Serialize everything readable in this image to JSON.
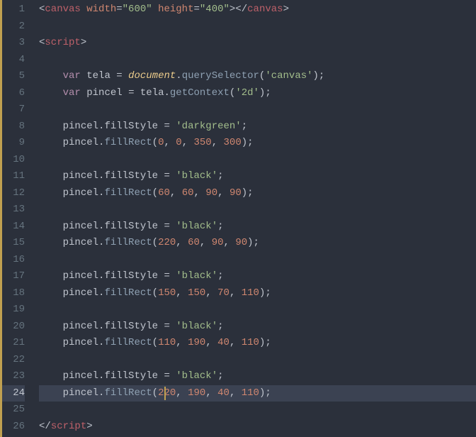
{
  "lines": [
    {
      "n": "1",
      "html": "<span class='punc'>&lt;</span><span class='tag'>canvas</span> <span class='attr'>width</span><span class='punc'>=</span><span class='str'>\"600\"</span> <span class='attr'>height</span><span class='punc'>=</span><span class='str'>\"400\"</span><span class='punc'>&gt;&lt;/</span><span class='tag'>canvas</span><span class='punc'>&gt;</span>"
    },
    {
      "n": "2",
      "html": ""
    },
    {
      "n": "3",
      "html": "<span class='punc'>&lt;</span><span class='tag'>script</span><span class='punc'>&gt;</span>"
    },
    {
      "n": "4",
      "html": ""
    },
    {
      "n": "5",
      "html": "    <span class='kw'>var</span> <span class='ident'>tela</span> <span class='punc'>=</span> <span class='obj'>document</span><span class='punc'>.</span><span class='prop'>querySelector</span><span class='punc'>(</span><span class='str'>'canvas'</span><span class='punc'>);</span>"
    },
    {
      "n": "6",
      "html": "    <span class='kw'>var</span> <span class='ident'>pincel</span> <span class='punc'>=</span> <span class='ident'>tela</span><span class='punc'>.</span><span class='prop'>getContext</span><span class='punc'>(</span><span class='str'>'2d'</span><span class='punc'>);</span>"
    },
    {
      "n": "7",
      "html": ""
    },
    {
      "n": "8",
      "html": "    <span class='ident'>pincel</span><span class='punc'>.</span><span class='ident'>fillStyle</span> <span class='punc'>=</span> <span class='str'>'darkgreen'</span><span class='punc'>;</span>"
    },
    {
      "n": "9",
      "html": "    <span class='ident'>pincel</span><span class='punc'>.</span><span class='prop'>fillRect</span><span class='punc'>(</span><span class='num'>0</span><span class='punc'>,</span> <span class='num'>0</span><span class='punc'>,</span> <span class='num'>350</span><span class='punc'>,</span> <span class='num'>300</span><span class='punc'>);</span>"
    },
    {
      "n": "10",
      "html": ""
    },
    {
      "n": "11",
      "html": "    <span class='ident'>pincel</span><span class='punc'>.</span><span class='ident'>fillStyle</span> <span class='punc'>=</span> <span class='str'>'black'</span><span class='punc'>;</span>"
    },
    {
      "n": "12",
      "html": "    <span class='ident'>pincel</span><span class='punc'>.</span><span class='prop'>fillRect</span><span class='punc'>(</span><span class='num'>60</span><span class='punc'>,</span> <span class='num'>60</span><span class='punc'>,</span> <span class='num'>90</span><span class='punc'>,</span> <span class='num'>90</span><span class='punc'>);</span>"
    },
    {
      "n": "13",
      "html": ""
    },
    {
      "n": "14",
      "html": "    <span class='ident'>pincel</span><span class='punc'>.</span><span class='ident'>fillStyle</span> <span class='punc'>=</span> <span class='str'>'black'</span><span class='punc'>;</span>"
    },
    {
      "n": "15",
      "html": "    <span class='ident'>pincel</span><span class='punc'>.</span><span class='prop'>fillRect</span><span class='punc'>(</span><span class='num'>220</span><span class='punc'>,</span> <span class='num'>60</span><span class='punc'>,</span> <span class='num'>90</span><span class='punc'>,</span> <span class='num'>90</span><span class='punc'>);</span>"
    },
    {
      "n": "16",
      "html": ""
    },
    {
      "n": "17",
      "html": "    <span class='ident'>pincel</span><span class='punc'>.</span><span class='ident'>fillStyle</span> <span class='punc'>=</span> <span class='str'>'black'</span><span class='punc'>;</span>"
    },
    {
      "n": "18",
      "html": "    <span class='ident'>pincel</span><span class='punc'>.</span><span class='prop'>fillRect</span><span class='punc'>(</span><span class='num'>150</span><span class='punc'>,</span> <span class='num'>150</span><span class='punc'>,</span> <span class='num'>70</span><span class='punc'>,</span> <span class='num'>110</span><span class='punc'>);</span>"
    },
    {
      "n": "19",
      "html": ""
    },
    {
      "n": "20",
      "html": "    <span class='ident'>pincel</span><span class='punc'>.</span><span class='ident'>fillStyle</span> <span class='punc'>=</span> <span class='str'>'black'</span><span class='punc'>;</span>"
    },
    {
      "n": "21",
      "html": "    <span class='ident'>pincel</span><span class='punc'>.</span><span class='prop'>fillRect</span><span class='punc'>(</span><span class='num'>110</span><span class='punc'>,</span> <span class='num'>190</span><span class='punc'>,</span> <span class='num'>40</span><span class='punc'>,</span> <span class='num'>110</span><span class='punc'>);</span>"
    },
    {
      "n": "22",
      "html": ""
    },
    {
      "n": "23",
      "html": "    <span class='ident'>pincel</span><span class='punc'>.</span><span class='ident'>fillStyle</span> <span class='punc'>=</span> <span class='str'>'black'</span><span class='punc'>;</span>"
    },
    {
      "n": "24",
      "active": true,
      "cursorCol": 23,
      "html": "    <span class='ident'>pincel</span><span class='punc'>.</span><span class='prop'>fillRect</span><span class='punc'>(</span><span class='num'>220</span><span class='punc'>,</span> <span class='num'>190</span><span class='punc'>,</span> <span class='num'>40</span><span class='punc'>,</span> <span class='num'>110</span><span class='punc'>);</span>"
    },
    {
      "n": "25",
      "html": ""
    },
    {
      "n": "26",
      "html": "<span class='punc'>&lt;/</span><span class='tag'>script</span><span class='punc'>&gt;</span>"
    }
  ],
  "charWidth": 7.7
}
